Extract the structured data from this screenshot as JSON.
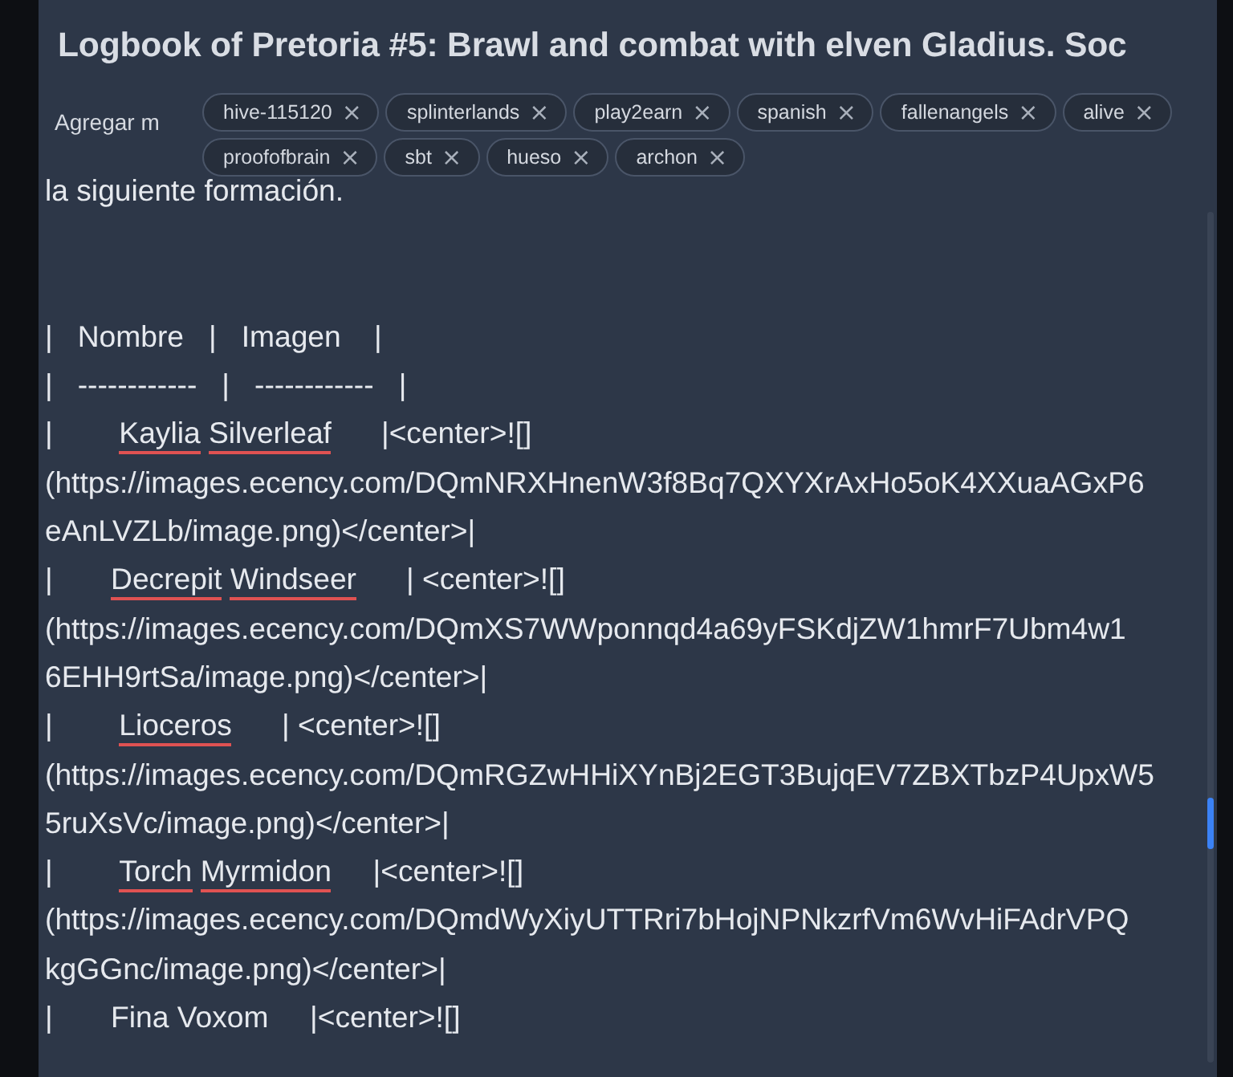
{
  "title": "Logbook of Pretoria #5: Brawl and combat with elven Gladius. Soc",
  "tag_input": {
    "placeholder": "Agregar m"
  },
  "tags": [
    {
      "label": "hive-115120"
    },
    {
      "label": "splinterlands"
    },
    {
      "label": "play2earn"
    },
    {
      "label": "spanish"
    },
    {
      "label": "fallenangels"
    },
    {
      "label": "alive"
    },
    {
      "label": "proofofbrain"
    },
    {
      "label": "sbt"
    },
    {
      "label": "hueso"
    },
    {
      "label": "archon"
    }
  ],
  "remove_glyph": "×",
  "intro_line": "la siguiente formación.",
  "editor_lines": [
    {
      "parts": [
        {
          "text": "|   Nombre   |   Imagen    |",
          "misspelled": false
        }
      ]
    },
    {
      "parts": [
        {
          "text": "|   ------------   |   ------------   |",
          "misspelled": false
        }
      ]
    },
    {
      "parts": [
        {
          "text": "|        ",
          "misspelled": false
        },
        {
          "text": "Kaylia Silverleaf",
          "misspelled": true
        },
        {
          "text": "      |<center>![]",
          "misspelled": false
        }
      ]
    },
    {
      "parts": [
        {
          "text": "(https://images.ecency.com/DQmNRXHnenW3f8Bq7QXYXrAxHo5oK4XXuaAGxP6",
          "misspelled": false
        }
      ]
    },
    {
      "parts": [
        {
          "text": "eAnLVZLb/image.png)</center>|",
          "misspelled": false
        }
      ]
    },
    {
      "parts": [
        {
          "text": "|       ",
          "misspelled": false
        },
        {
          "text": "Decrepit Windseer",
          "misspelled": true
        },
        {
          "text": "      | <center>![]",
          "misspelled": false
        }
      ]
    },
    {
      "parts": [
        {
          "text": "(https://images.ecency.com/DQmXS7WWponnqd4a69yFSKdjZW1hmrF7Ubm4w1",
          "misspelled": false
        }
      ]
    },
    {
      "parts": [
        {
          "text": "6EHH9rtSa/image.png)</center>|",
          "misspelled": false
        }
      ]
    },
    {
      "parts": [
        {
          "text": "|        ",
          "misspelled": false
        },
        {
          "text": "Lioceros",
          "misspelled": true
        },
        {
          "text": "      | <center>![]",
          "misspelled": false
        }
      ]
    },
    {
      "parts": [
        {
          "text": "(https://images.ecency.com/DQmRGZwHHiXYnBj2EGT3BujqEV7ZBXTbzP4UpxW5",
          "misspelled": false
        }
      ]
    },
    {
      "parts": [
        {
          "text": "5ruXsVc/image.png)</center>|",
          "misspelled": false
        }
      ]
    },
    {
      "parts": [
        {
          "text": "|        ",
          "misspelled": false
        },
        {
          "text": "Torch Myrmidon",
          "misspelled": true
        },
        {
          "text": "     |<center>![]",
          "misspelled": false
        }
      ]
    },
    {
      "parts": [
        {
          "text": "(https://images.ecency.com/DQmdWyXiyUTTRri7bHojNPNkzrfVm6WvHiFAdrVPQ",
          "misspelled": false
        }
      ]
    },
    {
      "parts": [
        {
          "text": "kgGGnc/image.png)</center>|",
          "misspelled": false
        }
      ]
    },
    {
      "parts": [
        {
          "text": "|       Fina Voxom     |<center>![]",
          "misspelled": false
        }
      ]
    }
  ]
}
